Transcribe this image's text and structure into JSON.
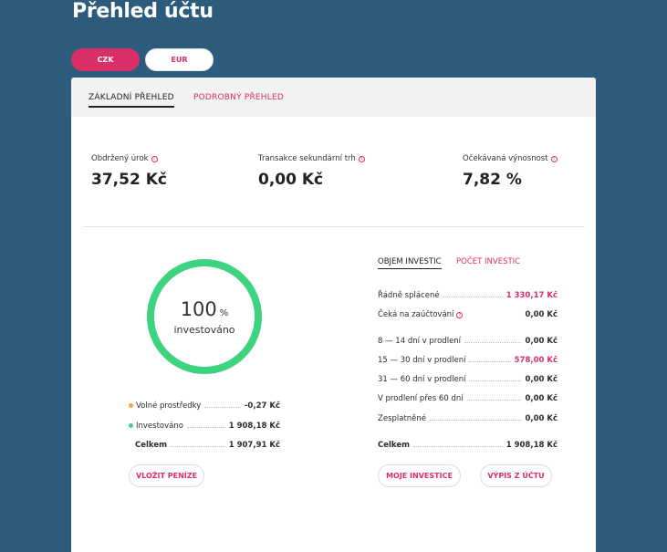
{
  "page": {
    "title": "Přehled účtu"
  },
  "currency": {
    "czk": "CZK",
    "eur": "EUR"
  },
  "tabs": {
    "basic": "ZÁKLADNÍ PŘEHLED",
    "detail": "PODROBNÝ PŘEHLED"
  },
  "stats": [
    {
      "label": "Obdržený úrok",
      "value": "37,52 Kč"
    },
    {
      "label": "Transakce sekundární trh",
      "value": "0,00 Kč"
    },
    {
      "label": "Očekávaná výnosnost",
      "value": "7,82 %"
    }
  ],
  "donut": {
    "percent": "100",
    "percent_sign": "%",
    "label": "investováno",
    "fraction": 1.0,
    "color": "#3dd47f"
  },
  "funds": [
    {
      "label": "Volné prostředky",
      "value": "-0,27 Kč",
      "dot": "#f5a83a"
    },
    {
      "label": "Investováno",
      "value": "1 908,18 Kč",
      "dot": "#3dd47f"
    },
    {
      "label": "Celkem",
      "value": "1 907,91 Kč",
      "dot": ""
    }
  ],
  "buttons": {
    "deposit": "VLOŽIT PENÍZE",
    "my_investments": "MOJE INVESTICE",
    "statement": "VÝPIS Z ÚČTU"
  },
  "subtabs": {
    "volume": "OBJEM INVESTIC",
    "count": "POČET INVESTIC"
  },
  "investments": [
    {
      "label": "Řádně splácené",
      "value": "1 330,17 Kč",
      "accent": true
    },
    {
      "label": "Čeká na zaúčtování",
      "value": "0,00 Kč",
      "info": true
    },
    {
      "label": "8 — 14 dní v prodlení",
      "value": "0,00 Kč"
    },
    {
      "label": "15 — 30 dní v prodlení",
      "value": "578,00 Kč",
      "accent": true
    },
    {
      "label": "31 — 60 dní v prodlení",
      "value": "0,00 Kč"
    },
    {
      "label": "V prodlení přes 60 dní",
      "value": "0,00 Kč"
    },
    {
      "label": "Zesplatněné",
      "value": "0,00 Kč"
    },
    {
      "label": "Celkem",
      "value": "1 908,18 Kč",
      "bold": true
    }
  ],
  "colors": {
    "accent": "#d92f66",
    "background": "#2c5b7c",
    "green": "#3dd47f",
    "orange": "#f5a83a"
  }
}
